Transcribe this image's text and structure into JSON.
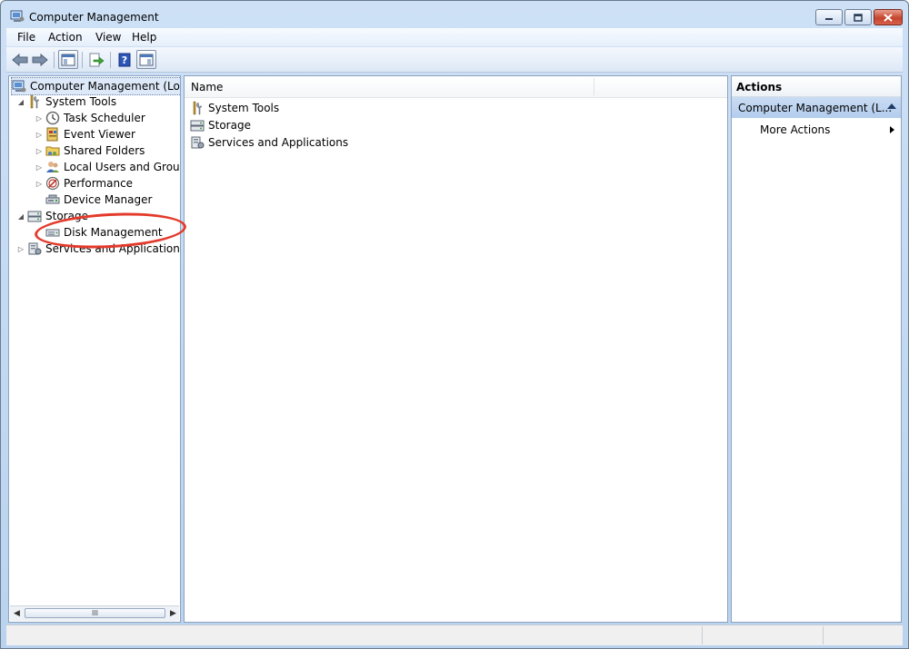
{
  "window": {
    "title": "Computer Management"
  },
  "menu": [
    "File",
    "Action",
    "View",
    "Help"
  ],
  "tree": {
    "root": "Computer Management (Local",
    "items": [
      {
        "label": "System Tools",
        "expanded": true
      },
      {
        "label": "Task Scheduler"
      },
      {
        "label": "Event Viewer"
      },
      {
        "label": "Shared Folders"
      },
      {
        "label": "Local Users and Groups"
      },
      {
        "label": "Performance"
      },
      {
        "label": "Device Manager"
      },
      {
        "label": "Storage",
        "expanded": true
      },
      {
        "label": "Disk Management"
      },
      {
        "label": "Services and Applications"
      }
    ],
    "scroll_thumb_grip": "III"
  },
  "main": {
    "column_name": "Name",
    "rows": [
      "System Tools",
      "Storage",
      "Services and Applications"
    ]
  },
  "actions": {
    "header": "Actions",
    "section": "Computer Management (L...",
    "items": [
      "More Actions"
    ]
  },
  "colors": {
    "highlight_ring": "#e33a2b",
    "selection": "#dde9f8",
    "section_bg": "#c9dcf3"
  }
}
